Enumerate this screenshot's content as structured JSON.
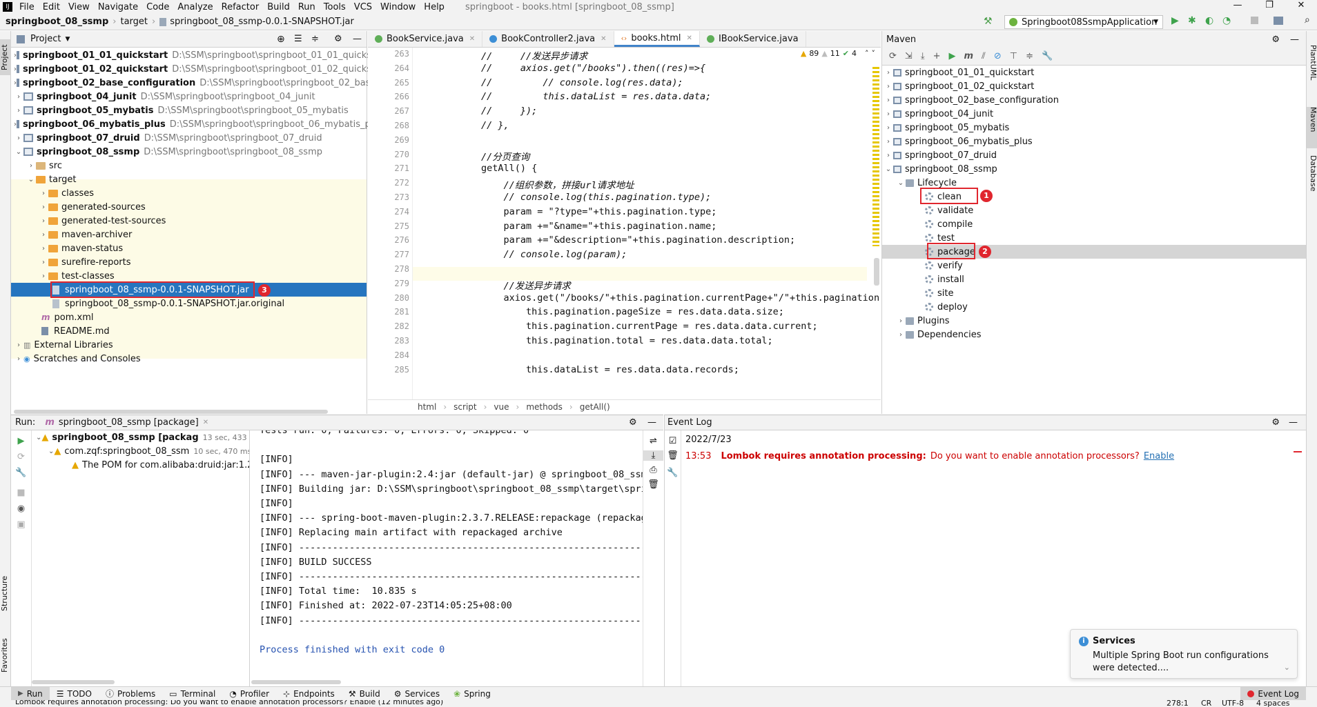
{
  "menu": {
    "items": [
      "File",
      "Edit",
      "View",
      "Navigate",
      "Code",
      "Analyze",
      "Refactor",
      "Build",
      "Run",
      "Tools",
      "VCS",
      "Window",
      "Help"
    ],
    "title": "springboot - books.html [springboot_08_ssmp]"
  },
  "nav": {
    "crumbs": [
      "springboot_08_ssmp",
      "target",
      "springboot_08_ssmp-0.0.1-SNAPSHOT.jar"
    ],
    "run_config": "Springboot08SsmpApplication"
  },
  "project": {
    "header": "Project",
    "items": [
      {
        "name": "springboot_01_01_quickstart",
        "path": "D:\\SSM\\springboot\\springboot_01_01_quickstart"
      },
      {
        "name": "springboot_01_02_quickstart",
        "path": "D:\\SSM\\springboot\\springboot_01_02_quickstart"
      },
      {
        "name": "springboot_02_base_configuration",
        "path": "D:\\SSM\\springboot\\springboot_02_base_co"
      },
      {
        "name": "springboot_04_junit",
        "path": "D:\\SSM\\springboot\\springboot_04_junit"
      },
      {
        "name": "springboot_05_mybatis",
        "path": "D:\\SSM\\springboot\\springboot_05_mybatis"
      },
      {
        "name": "springboot_06_mybatis_plus",
        "path": "D:\\SSM\\springboot\\springboot_06_mybatis_plus"
      },
      {
        "name": "springboot_07_druid",
        "path": "D:\\SSM\\springboot\\springboot_07_druid"
      },
      {
        "name": "springboot_08_ssmp",
        "path": "D:\\SSM\\springboot\\springboot_08_ssmp"
      }
    ],
    "src": "src",
    "target": "target",
    "target_children": [
      "classes",
      "generated-sources",
      "generated-test-sources",
      "maven-archiver",
      "maven-status",
      "surefire-reports",
      "test-classes"
    ],
    "jar": "springboot_08_ssmp-0.0.1-SNAPSHOT.jar",
    "jar_original": "springboot_08_ssmp-0.0.1-SNAPSHOT.jar.original",
    "pom": "pom.xml",
    "readme": "README.md",
    "ext": "External Libraries",
    "scratch": "Scratches and Consoles"
  },
  "tabs": [
    "BookService.java",
    "BookController2.java",
    "books.html",
    "IBookService.java"
  ],
  "editor": {
    "warnings": "89",
    "weak": "11",
    "ok": "4",
    "lines": [
      "263",
      "264",
      "265",
      "266",
      "267",
      "268",
      "269",
      "270",
      "271",
      "272",
      "273",
      "274",
      "275",
      "276",
      "277",
      "278",
      "279",
      "280",
      "281",
      "282",
      "283",
      "284",
      "285"
    ],
    "code": [
      "//     //发送异步请求",
      "//     axios.get(\"/books\").then((res)=>{",
      "//         // console.log(res.data);",
      "//         this.dataList = res.data.data;",
      "//     });",
      "// },",
      "",
      "//分页查询",
      "getAll() {",
      "    //组织参数，拼接url请求地址",
      "    // console.log(this.pagination.type);",
      "    param = \"?type=\"+this.pagination.type;",
      "    param +=\"&name=\"+this.pagination.name;",
      "    param +=\"&description=\"+this.pagination.description;",
      "    // console.log(param);",
      "",
      "    //发送异步请求",
      "    axios.get(\"/books/\"+this.pagination.currentPage+\"/\"+this.pagination.",
      "        this.pagination.pageSize = res.data.data.size;",
      "        this.pagination.currentPage = res.data.data.current;",
      "        this.pagination.total = res.data.data.total;",
      "",
      "        this.dataList = res.data.data.records;"
    ],
    "breadcrumb": [
      "html",
      "script",
      "vue",
      "methods",
      "getAll()"
    ]
  },
  "maven": {
    "header": "Maven",
    "projects": [
      "springboot_01_01_quickstart",
      "springboot_01_02_quickstart",
      "springboot_02_base_configuration",
      "springboot_04_junit",
      "springboot_05_mybatis",
      "springboot_06_mybatis_plus",
      "springboot_07_druid",
      "springboot_08_ssmp"
    ],
    "lifecycle": "Lifecycle",
    "phases": [
      "clean",
      "validate",
      "compile",
      "test",
      "package",
      "verify",
      "install",
      "site",
      "deploy"
    ],
    "plugins": "Plugins",
    "deps": "Dependencies"
  },
  "annotations": [
    "1",
    "2",
    "3"
  ],
  "run": {
    "label": "Run:",
    "tab": "springboot_08_ssmp [package]",
    "tree": [
      {
        "name": "springboot_08_ssmp [packag",
        "time": "13 sec, 433 ms"
      },
      {
        "name": "com.zqf:springboot_08_ssm",
        "time": "10 sec, 470 ms"
      },
      {
        "name": "The POM for com.alibaba:druid:jar:1.2",
        "time": ""
      }
    ],
    "console": [
      "Tests run: 0, Failures: 0, Errors: 0, Skipped: 0",
      "",
      "[INFO]",
      "[INFO] --- maven-jar-plugin:2.4:jar (default-jar) @ springboot_08_ssmp",
      "[INFO] Building jar: D:\\SSM\\springboot\\springboot_08_ssmp\\target\\spring",
      "[INFO]",
      "[INFO] --- spring-boot-maven-plugin:2.3.7.RELEASE:repackage (repackage)",
      "[INFO] Replacing main artifact with repackaged archive",
      "[INFO] ------------------------------------------------------------------------",
      "[INFO] BUILD SUCCESS",
      "[INFO] ------------------------------------------------------------------------",
      "[INFO] Total time:  10.835 s",
      "[INFO] Finished at: 2022-07-23T14:05:25+08:00",
      "[INFO] ------------------------------------------------------------------------",
      "",
      "Process finished with exit code 0"
    ]
  },
  "eventlog": {
    "header": "Event Log",
    "date": "2022/7/23",
    "time": "13:53",
    "title": "Lombok requires annotation processing:",
    "msg": "Do you want to enable annotation processors?",
    "link": "Enable"
  },
  "services": {
    "title": "Services",
    "body1": "Multiple Spring Boot run configurations",
    "body2": "were detected...."
  },
  "bottom": {
    "tools": [
      "Run",
      "TODO",
      "Problems",
      "Terminal",
      "Profiler",
      "Endpoints",
      "Build",
      "Services",
      "Spring"
    ],
    "eventlog": "Event Log"
  },
  "status": {
    "text": "Lombok requires annotation processing: Do you want to enable annotation processors? Enable (12 minutes ago)",
    "pos": "278:1",
    "enc": "CR",
    "charset": "UTF-8",
    "indent": "4 spaces"
  },
  "side": {
    "left": [
      "Project",
      "Structure",
      "Favorites"
    ],
    "right": [
      "PlantUML",
      "Maven",
      "Database"
    ]
  }
}
